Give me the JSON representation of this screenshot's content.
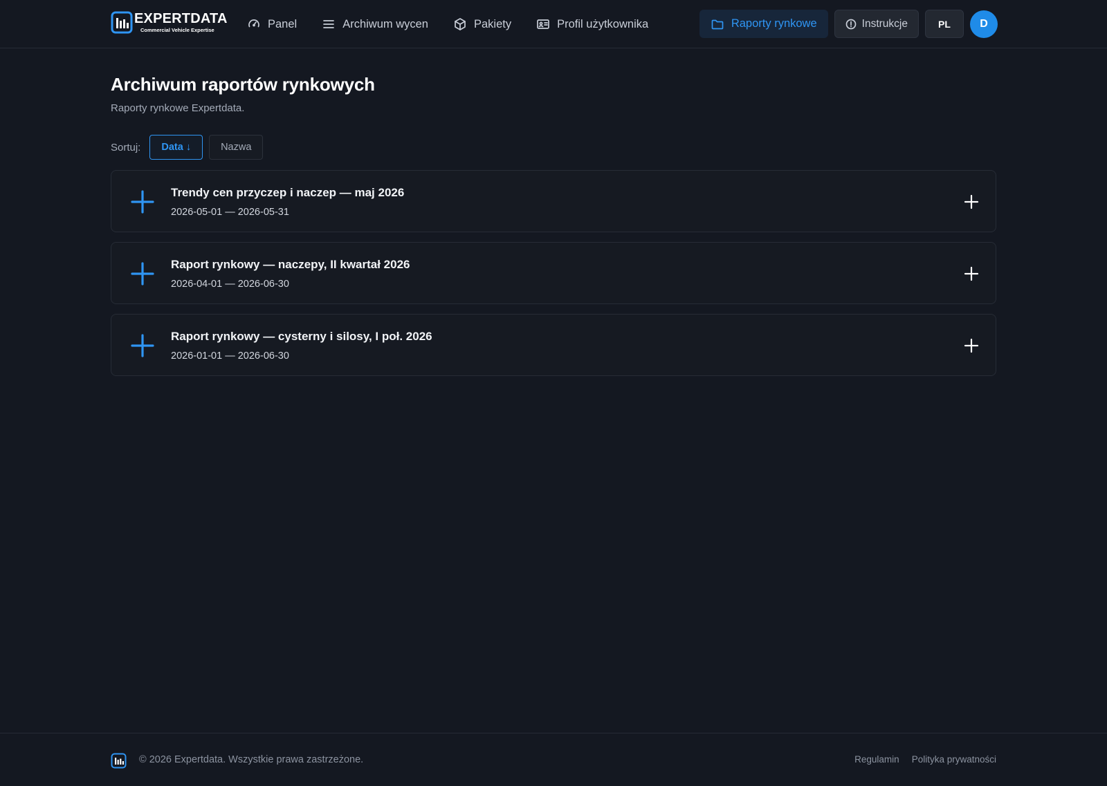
{
  "brand": {
    "name": "EXPERTDATA",
    "tagline": "Commercial Vehicle Expertise",
    "accent": "#2f95f3"
  },
  "nav": {
    "items": [
      {
        "label": "Panel",
        "icon": "gauge-icon"
      },
      {
        "label": "Archiwum wycen",
        "icon": "menu-lines-icon"
      },
      {
        "label": "Pakiety",
        "icon": "package-box-icon"
      },
      {
        "label": "Profil użytkownika",
        "icon": "id-card-icon"
      }
    ]
  },
  "actions": {
    "reports_label": "Raporty rynkowe",
    "instructions_label": "Instrukcje",
    "language": "PL",
    "avatar_initial": "D"
  },
  "main": {
    "title": "Archiwum raportów rynkowych",
    "subtitle": "Raporty rynkowe Expertdata.",
    "sort": {
      "label": "Sortuj:",
      "options": [
        {
          "label": "Data ↓",
          "active": true
        },
        {
          "label": "Nazwa",
          "active": false
        }
      ]
    },
    "reports": [
      {
        "title": "Trendy cen przyczep i naczep — maj 2026",
        "dates": "2026-05-01 — 2026-05-31"
      },
      {
        "title": "Raport rynkowy — naczepy, II kwartał 2026",
        "dates": "2026-04-01 — 2026-06-30"
      },
      {
        "title": "Raport rynkowy — cysterny i silosy, I poł. 2026",
        "dates": "2026-01-01 — 2026-06-30"
      }
    ]
  },
  "footer": {
    "copyright": "© 2026 Expertdata. Wszystkie prawa zastrzeżone.",
    "links": [
      "Regulamin",
      "Polityka prywatności"
    ]
  }
}
